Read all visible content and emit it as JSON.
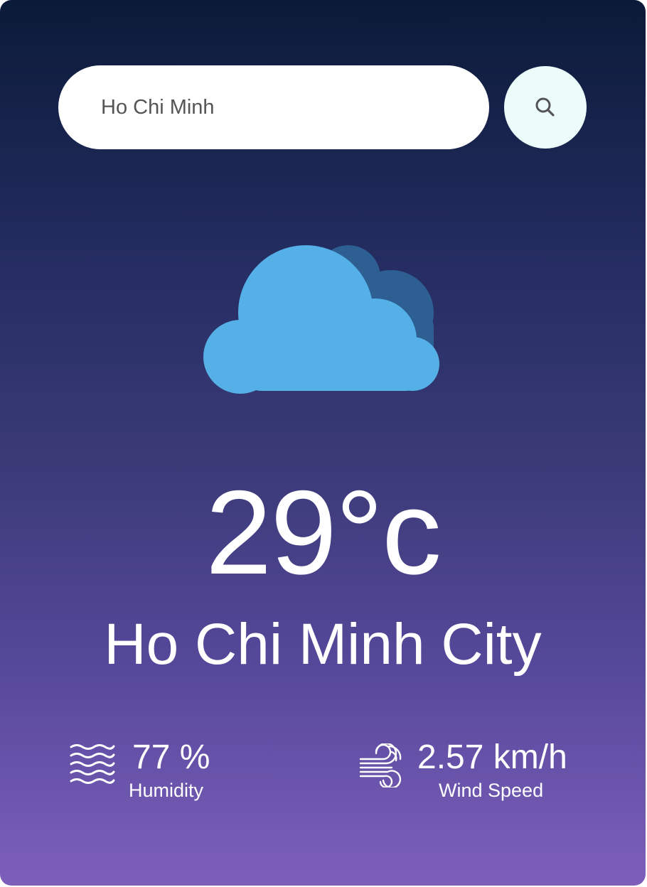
{
  "search": {
    "value": "Ho Chi Minh",
    "button_icon": "search-icon"
  },
  "weather": {
    "icon": "cloud-icon",
    "temperature": "29°c",
    "city": "Ho Chi Minh City"
  },
  "humidity": {
    "icon": "humidity-waves-icon",
    "value": "77 %",
    "label": "Humidity"
  },
  "wind": {
    "icon": "wind-icon",
    "value": "2.57 km/h",
    "label": "Wind Speed"
  },
  "colors": {
    "gradient_top": "#0b1a38",
    "gradient_bottom": "#7d5fbb",
    "search_button_bg": "#ecfcfb",
    "cloud_front": "#55b0e8",
    "cloud_back": "#2e5f93"
  }
}
